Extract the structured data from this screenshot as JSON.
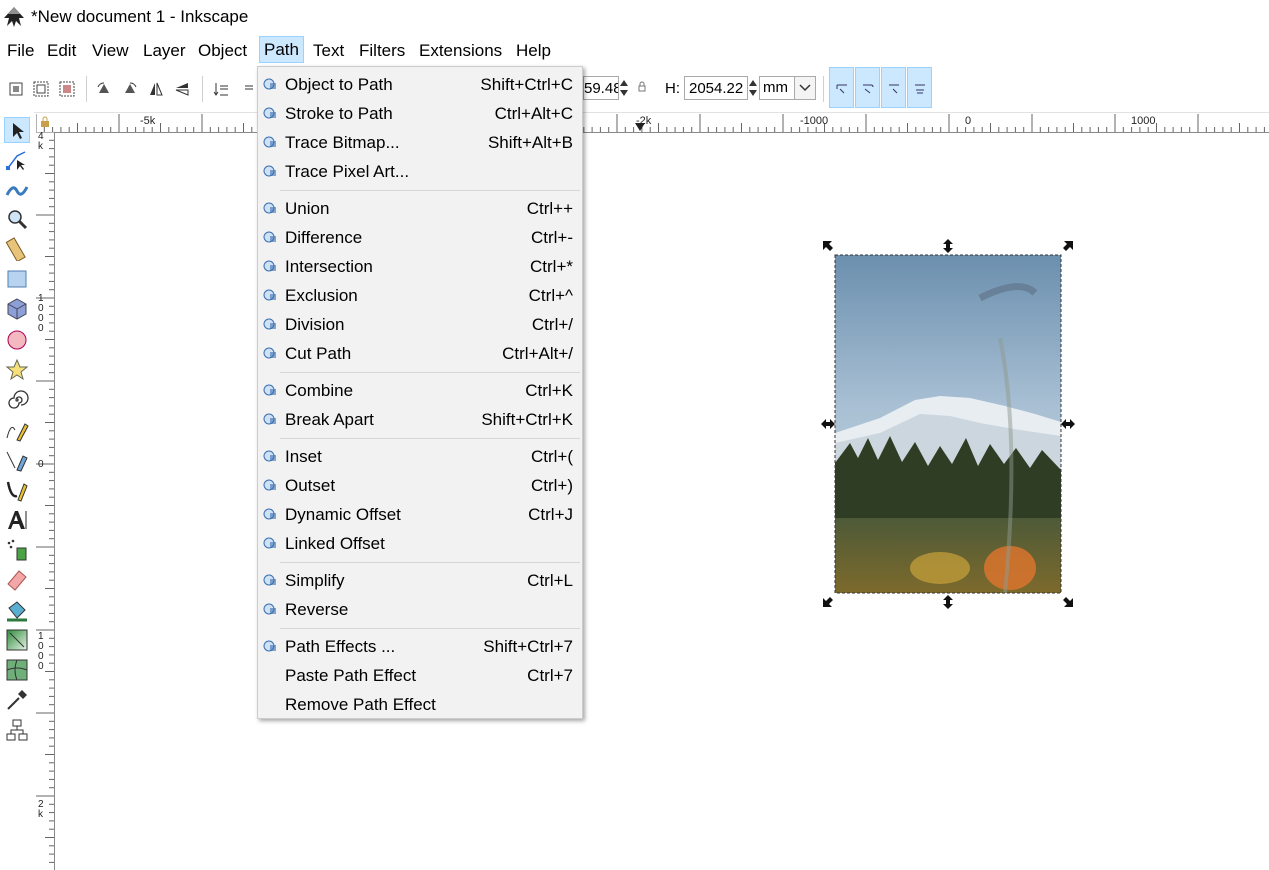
{
  "window": {
    "title": "*New document 1 - Inkscape"
  },
  "menubar": {
    "items": [
      "File",
      "Edit",
      "View",
      "Layer",
      "Object",
      "Path",
      "Text",
      "Filters",
      "Extensions",
      "Help"
    ],
    "open_menu": "Path"
  },
  "toolbar": {
    "w_value": "59.48",
    "h_label": "H:",
    "h_value": "2054.22",
    "unit": "mm"
  },
  "ruler": {
    "h_labels": [
      "-5k",
      "-2k",
      "-1000",
      "0",
      "1000"
    ],
    "v_labels": [
      "4 k",
      "1 0 0 0",
      "0",
      "1 0 0 0",
      "2 k"
    ]
  },
  "path_menu": {
    "groups": [
      [
        {
          "label": "Object to Path",
          "shortcut": "Shift+Ctrl+C",
          "icon": "object-to-path-icon"
        },
        {
          "label": "Stroke to Path",
          "shortcut": "Ctrl+Alt+C",
          "icon": "stroke-to-path-icon"
        },
        {
          "label": "Trace Bitmap...",
          "shortcut": "Shift+Alt+B",
          "icon": "trace-bitmap-icon"
        },
        {
          "label": "Trace Pixel Art...",
          "shortcut": "",
          "icon": "trace-pixel-art-icon"
        }
      ],
      [
        {
          "label": "Union",
          "shortcut": "Ctrl++",
          "icon": "union-icon"
        },
        {
          "label": "Difference",
          "shortcut": "Ctrl+-",
          "icon": "difference-icon"
        },
        {
          "label": "Intersection",
          "shortcut": "Ctrl+*",
          "icon": "intersection-icon"
        },
        {
          "label": "Exclusion",
          "shortcut": "Ctrl+^",
          "icon": "exclusion-icon"
        },
        {
          "label": "Division",
          "shortcut": "Ctrl+/",
          "icon": "division-icon"
        },
        {
          "label": "Cut Path",
          "shortcut": "Ctrl+Alt+/",
          "icon": "cut-path-icon"
        }
      ],
      [
        {
          "label": "Combine",
          "shortcut": "Ctrl+K",
          "icon": "combine-icon"
        },
        {
          "label": "Break Apart",
          "shortcut": "Shift+Ctrl+K",
          "icon": "break-apart-icon"
        }
      ],
      [
        {
          "label": "Inset",
          "shortcut": "Ctrl+(",
          "icon": "inset-icon"
        },
        {
          "label": "Outset",
          "shortcut": "Ctrl+)",
          "icon": "outset-icon"
        },
        {
          "label": "Dynamic Offset",
          "shortcut": "Ctrl+J",
          "icon": "dynamic-offset-icon"
        },
        {
          "label": "Linked Offset",
          "shortcut": "",
          "icon": "linked-offset-icon"
        }
      ],
      [
        {
          "label": "Simplify",
          "shortcut": "Ctrl+L",
          "icon": "simplify-icon"
        },
        {
          "label": "Reverse",
          "shortcut": "",
          "icon": "reverse-icon"
        }
      ],
      [
        {
          "label": "Path Effects ...",
          "shortcut": "Shift+Ctrl+7",
          "icon": "path-effects-icon"
        },
        {
          "label": "Paste Path Effect",
          "shortcut": "Ctrl+7",
          "icon": ""
        },
        {
          "label": "Remove Path Effect",
          "shortcut": "",
          "icon": ""
        }
      ]
    ]
  },
  "colors": {
    "highlight": "#cce8ff",
    "highlight_border": "#99d1ff",
    "menu_bg": "#f2f2f2"
  }
}
